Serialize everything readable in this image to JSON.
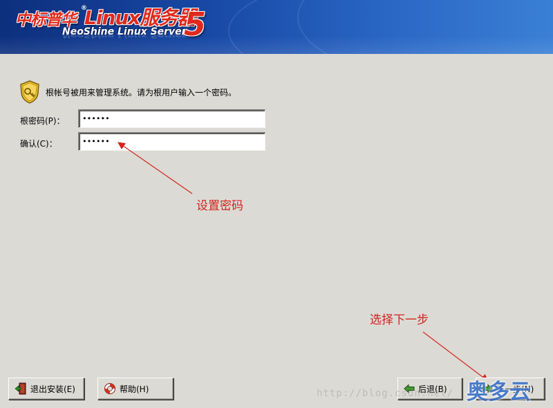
{
  "banner": {
    "brand_cn": "中标普华",
    "registered": "®",
    "brand_linux": "Linux服务器",
    "brand_en": "NeoShine Linux Server",
    "version": "5",
    "colors": {
      "background": "#1849a6",
      "logo_red": "#e0291c"
    }
  },
  "content": {
    "intro_icon": "shield-key-icon",
    "intro": "根帐号被用来管理系统。请为根用户输入一个密码。",
    "root_password": {
      "label": "根密码(P)：",
      "value": "••••••"
    },
    "confirm": {
      "label": "确认(C)：",
      "value": "••••••"
    }
  },
  "annotations": {
    "set_password": "设置密码",
    "choose_next": "选择下一步",
    "color": "#d2241c"
  },
  "buttons": {
    "exit": {
      "label": "退出安装(E)",
      "icon": "exit-door-icon"
    },
    "help": {
      "label": "帮助(H)",
      "icon": "lifebuoy-icon"
    },
    "back": {
      "label": "后退(B)",
      "icon": "arrow-left-icon"
    },
    "next": {
      "label": "下一步(N)",
      "icon": "arrow-right-icon"
    }
  },
  "watermark": "http://blog.csdn.net/",
  "corner_watermark": "奥多云"
}
